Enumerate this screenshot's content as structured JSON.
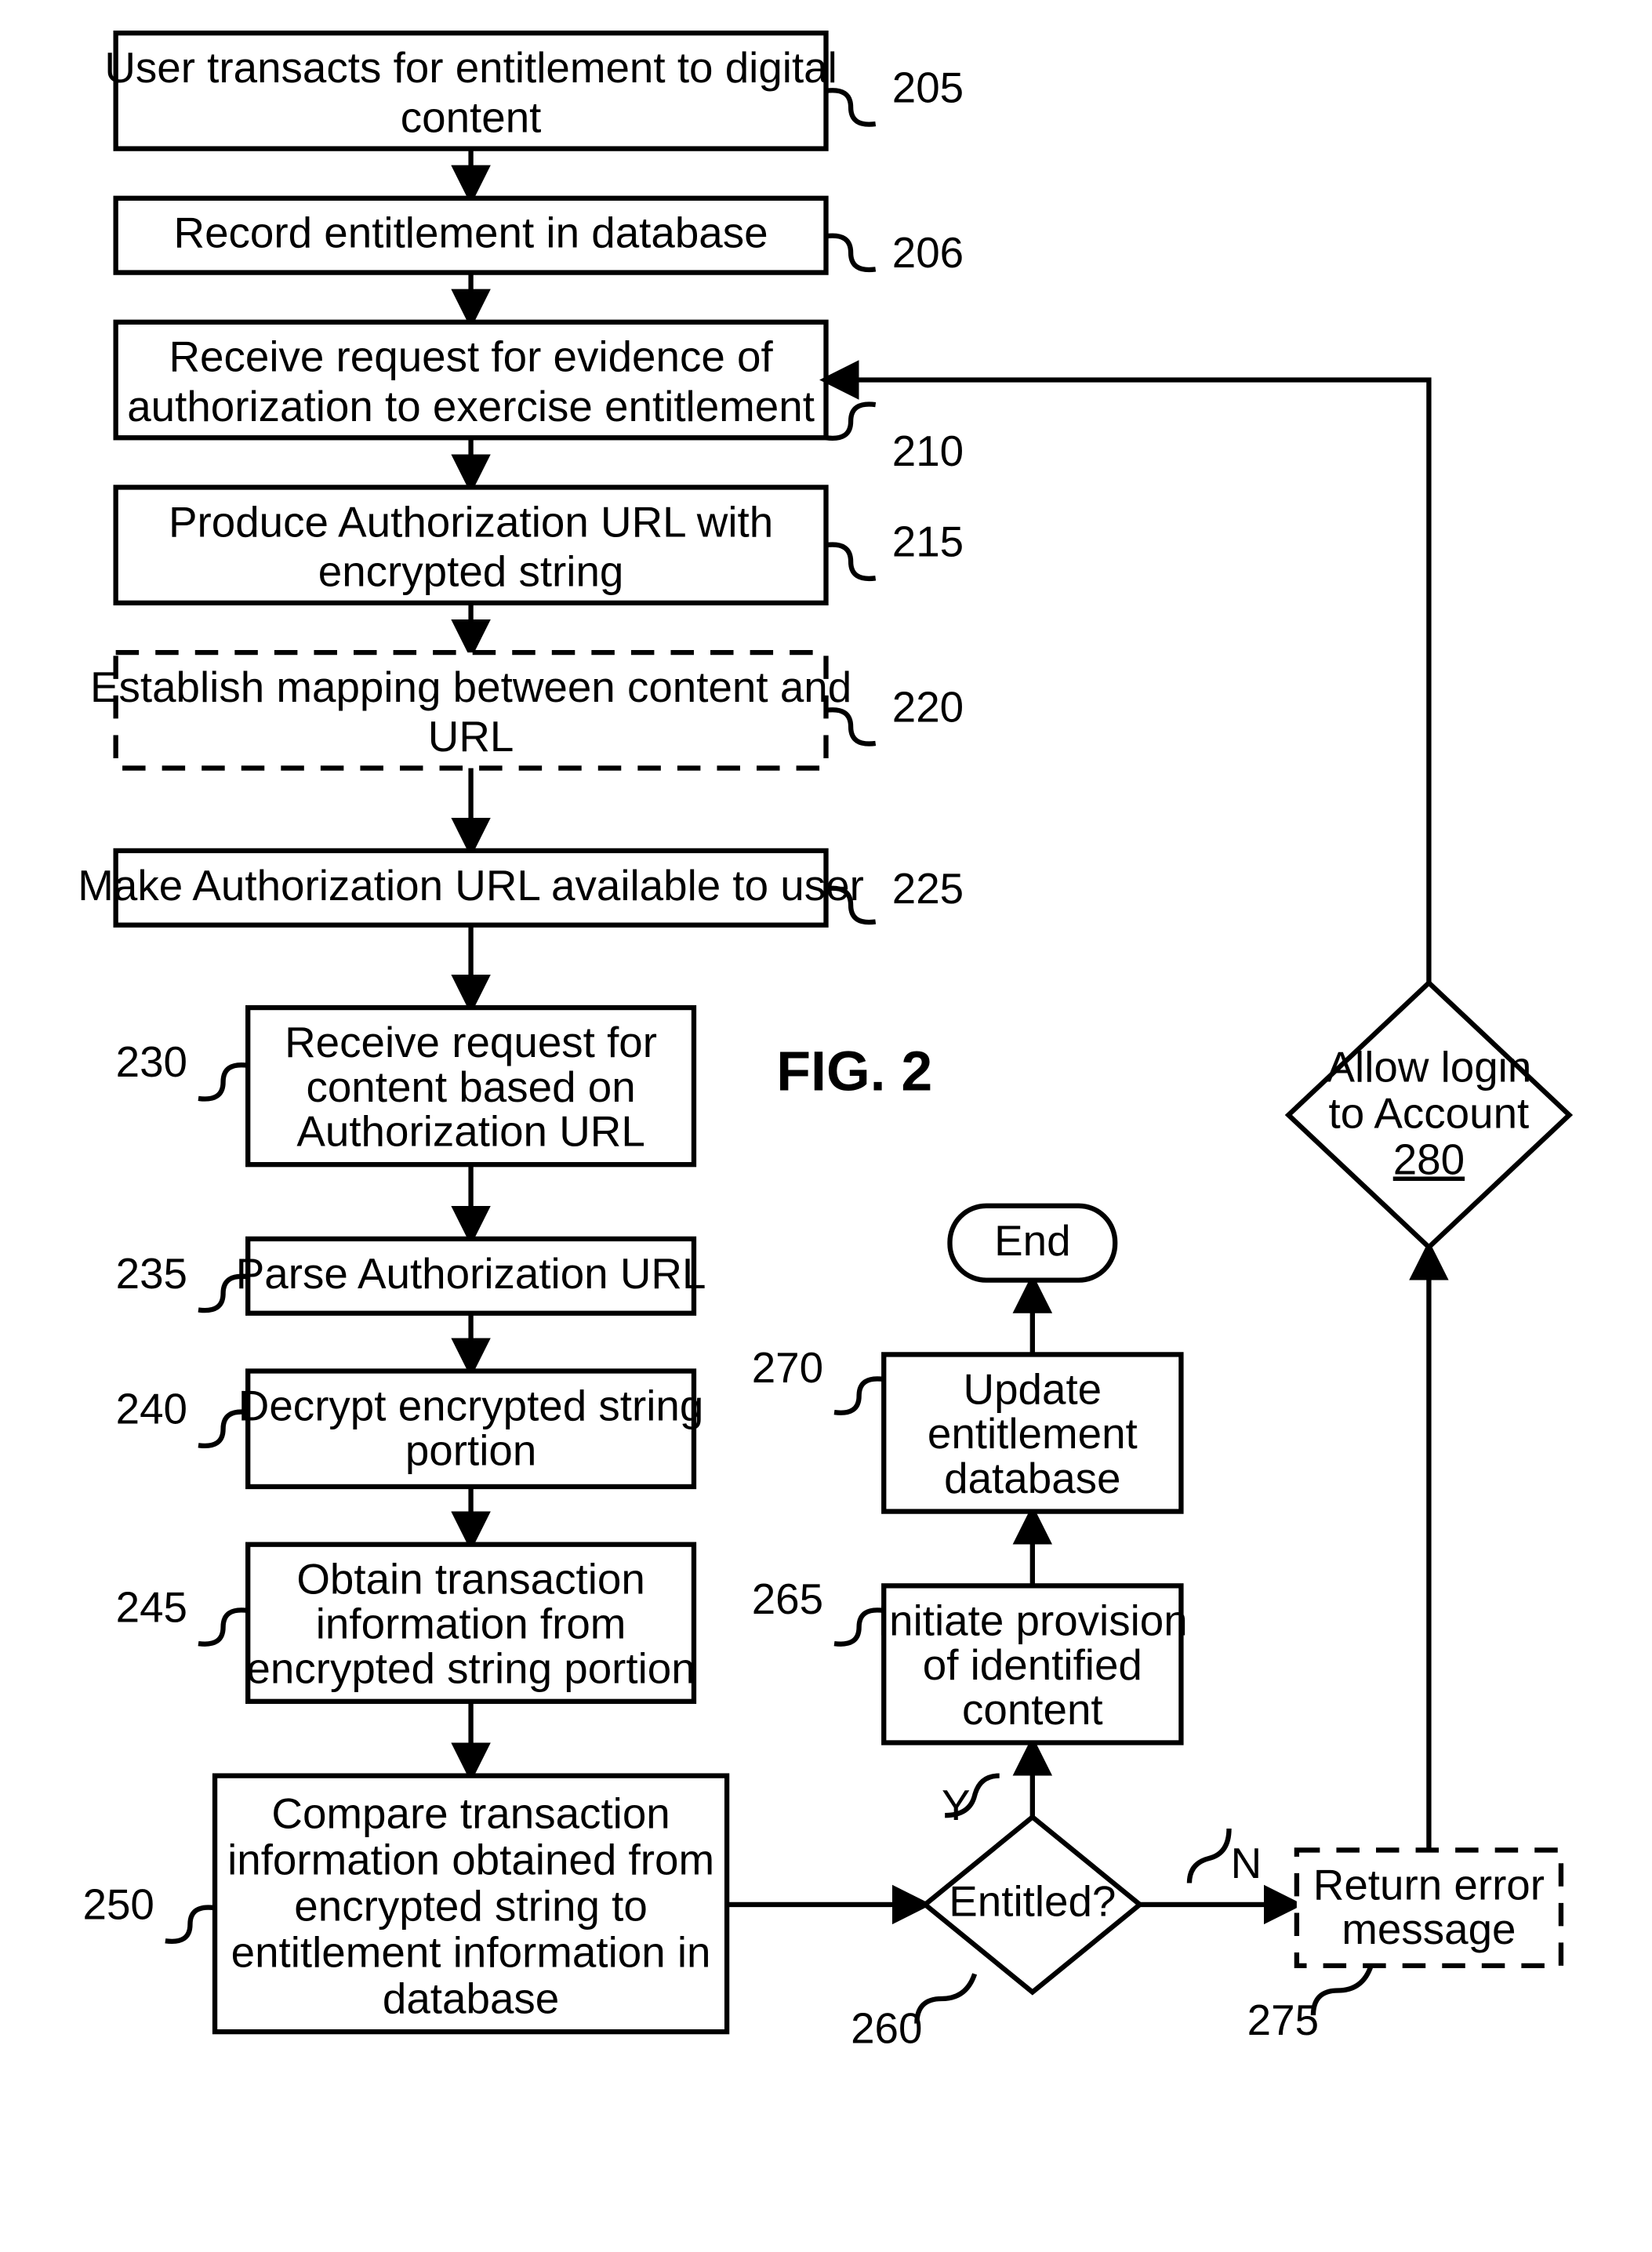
{
  "figure_label": "FIG. 2",
  "steps": {
    "s205": {
      "ref": "205",
      "text": [
        "User transacts for entitlement to digital",
        "content"
      ]
    },
    "s206": {
      "ref": "206",
      "text": [
        "Record entitlement in database"
      ]
    },
    "s210": {
      "ref": "210",
      "text": [
        "Receive request for evidence of",
        "authorization to exercise entitlement"
      ]
    },
    "s215": {
      "ref": "215",
      "text": [
        "Produce Authorization URL with",
        "encrypted string"
      ]
    },
    "s220": {
      "ref": "220",
      "text": [
        "Establish mapping between content and",
        "URL"
      ]
    },
    "s225": {
      "ref": "225",
      "text": [
        "Make Authorization URL available to user"
      ]
    },
    "s230": {
      "ref": "230",
      "text": [
        "Receive request for",
        "content based on",
        "Authorization URL"
      ]
    },
    "s235": {
      "ref": "235",
      "text": [
        "Parse Authorization URL"
      ]
    },
    "s240": {
      "ref": "240",
      "text": [
        "Decrypt encrypted string",
        "portion"
      ]
    },
    "s245": {
      "ref": "245",
      "text": [
        "Obtain transaction",
        "information from",
        "encrypted string portion"
      ]
    },
    "s250": {
      "ref": "250",
      "text": [
        "Compare transaction",
        "information obtained from",
        "encrypted string to",
        "entitlement information in",
        "database"
      ]
    },
    "s260": {
      "ref": "260",
      "text": [
        "Entitled?"
      ],
      "yes": "Y",
      "no": "N"
    },
    "s265": {
      "ref": "265",
      "text": [
        "Initiate provision",
        "of identified",
        "content"
      ]
    },
    "s270": {
      "ref": "270",
      "text": [
        "Update",
        "entitlement",
        "database"
      ]
    },
    "s275": {
      "ref": "275",
      "text": [
        "Return error",
        "message"
      ]
    },
    "s280": {
      "ref": "280",
      "text": [
        "Allow login",
        "to Account"
      ]
    },
    "end": {
      "text": [
        "End"
      ]
    }
  }
}
